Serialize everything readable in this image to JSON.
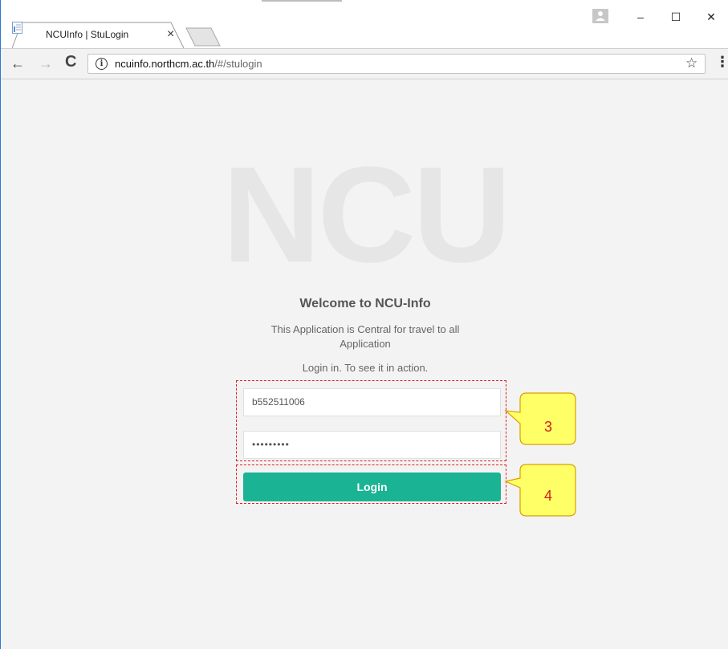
{
  "browser": {
    "tab_title": "NCUInfo | StuLogin",
    "tab_close": "×",
    "url_host": "ncuinfo.northcm.ac.th",
    "url_path": "/#/stulogin",
    "nav_back": "←",
    "nav_forward": "→",
    "nav_reload": "C",
    "bookmark_star": "☆",
    "menu": "⋮",
    "window_minimize": "–",
    "window_maximize": "☐",
    "window_close": "✕"
  },
  "page": {
    "watermark": "NCU",
    "welcome_title": "Welcome to NCU-Info",
    "description": "This Application is Central for travel to all Application",
    "login_hint": "Login in. To see it in action.",
    "username_value": "b552511006",
    "password_value": "•••••••••",
    "login_button": "Login"
  },
  "annotations": {
    "callout_3": "3",
    "callout_4": "4"
  },
  "colors": {
    "login_button": "#1ab394",
    "annotation_border": "#e02020",
    "callout_fill": "#ffff66"
  }
}
